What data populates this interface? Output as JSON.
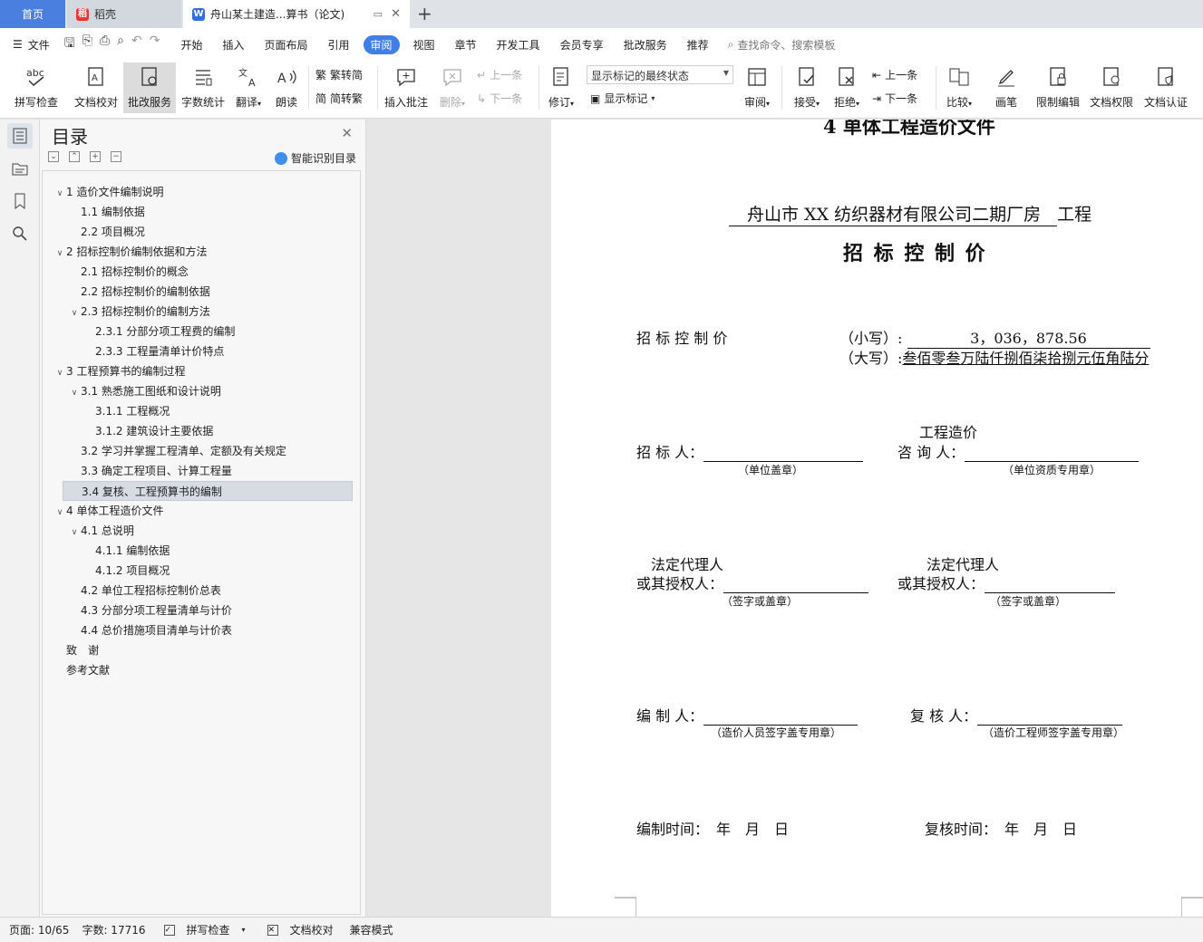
{
  "tabs": {
    "home": "首页",
    "daoke": "稻壳",
    "doc": "舟山某土建造...算书（论文)"
  },
  "menu": {
    "file": "文件",
    "items": [
      "开始",
      "插入",
      "页面布局",
      "引用",
      "审阅",
      "视图",
      "章节",
      "开发工具",
      "会员专享",
      "批改服务",
      "推荐"
    ],
    "active_index": 4,
    "search_placeholder": "查找命令、搜索模板"
  },
  "ribbon": {
    "spell": "拼写检查",
    "doc_check": "文档校对",
    "revise_service": "批改服务",
    "word_count": "字数统计",
    "translate": "翻译",
    "read_aloud": "朗读",
    "to_traditional": "繁转简",
    "to_simplified": "简转繁",
    "insert_comment": "插入批注",
    "delete": "删除",
    "prev": "上一条",
    "next": "下一条",
    "track": "修订",
    "markup_select": "显示标记的最终状态",
    "show_markup": "显示标记",
    "review": "审阅",
    "accept": "接受",
    "reject": "拒绝",
    "prev2": "上一条",
    "next2": "下一条",
    "compare": "比较",
    "pen": "画笔",
    "restrict": "限制编辑",
    "permission": "文档权限",
    "certify": "文档认证"
  },
  "toc": {
    "title": "目录",
    "smart": "智能识别目录",
    "items": [
      {
        "text": "1 造价文件编制说明",
        "level": 1,
        "arrow": true
      },
      {
        "text": "1.1 编制依据",
        "level": 2,
        "arrow": false
      },
      {
        "text": "2.2  项目概况",
        "level": 2,
        "arrow": false
      },
      {
        "text": "2 招标控制价编制依据和方法",
        "level": 1,
        "arrow": true
      },
      {
        "text": "2.1 招标控制价的概念",
        "level": 2,
        "arrow": false
      },
      {
        "text": "2.2 招标控制价的编制依据",
        "level": 2,
        "arrow": false
      },
      {
        "text": "2.3 招标控制价的编制方法",
        "level": 2,
        "arrow": true
      },
      {
        "text": "2.3.1 分部分项工程费的编制",
        "level": 3,
        "arrow": false
      },
      {
        "text": "2.3.3 工程量清单计价特点",
        "level": 3,
        "arrow": false
      },
      {
        "text": "3 工程预算书的编制过程",
        "level": 1,
        "arrow": true
      },
      {
        "text": "3.1 熟悉施工图纸和设计说明",
        "level": 2,
        "arrow": true
      },
      {
        "text": "3.1.1 工程概况",
        "level": 3,
        "arrow": false
      },
      {
        "text": "3.1.2 建筑设计主要依据",
        "level": 3,
        "arrow": false
      },
      {
        "text": "3.2 学习并掌握工程清单、定额及有关规定",
        "level": 2,
        "arrow": false
      },
      {
        "text": "3.3 确定工程项目、计算工程量",
        "level": 2,
        "arrow": false
      },
      {
        "text": "3.4 复核、工程预算书的编制",
        "level": 2,
        "arrow": false,
        "selected": true
      },
      {
        "text": "4 单体工程造价文件",
        "level": 1,
        "arrow": true
      },
      {
        "text": "4.1 总说明",
        "level": 2,
        "arrow": true
      },
      {
        "text": "4.1.1 编制依据",
        "level": 3,
        "arrow": false
      },
      {
        "text": "4.1.2 项目概况",
        "level": 3,
        "arrow": false
      },
      {
        "text": "4.2 单位工程招标控制价总表",
        "level": 2,
        "arrow": false
      },
      {
        "text": "4.3 分部分项工程量清单与计价",
        "level": 2,
        "arrow": false
      },
      {
        "text": "4.4 总价措施项目清单与计价表",
        "level": 2,
        "arrow": false
      },
      {
        "text": "致　谢",
        "level": 1,
        "arrow": false
      },
      {
        "text": "参考文献",
        "level": 1,
        "arrow": false
      }
    ]
  },
  "document": {
    "heading_partial": "4 单体工程造价文件",
    "project_name": "舟山市 XX 纺织器材有限公司二期厂房",
    "project_suffix": "工程",
    "title": "招 标 控 制 价",
    "price_label": "招 标 控 制 价",
    "small_label": "（小写）:",
    "small_value": "3，036，878.56",
    "big_label": "（大写）:",
    "big_value": "叁佰零叁万陆仟捌佰柒拾捌元伍角陆分",
    "tenderer_label": "招 标 人：",
    "tenderer_note": "（单位盖章）",
    "consult_label1": "工程造价",
    "consult_label2": "咨 询 人：",
    "consult_note": "（单位资质专用章）",
    "legal1_line1": "法定代理人",
    "legal1_line2": "或其授权人：",
    "legal1_note": "（签字或盖章）",
    "legal2_line1": "法定代理人",
    "legal2_line2": "或其授权人：",
    "legal2_note": "（签字或盖章）",
    "compiler_label": "编 制 人：",
    "compiler_note": "（造价人员签字盖专用章）",
    "reviewer_label": "复 核 人：",
    "reviewer_note": "（造价工程师签字盖专用章）",
    "compile_time": "编制时间：　年　月　日",
    "review_time": "复核时间：　年　月　日"
  },
  "status": {
    "page": "页面: 10/65",
    "words": "字数: 17716",
    "spell": "拼写检查",
    "doc_check": "文档校对",
    "compat": "兼容模式"
  }
}
